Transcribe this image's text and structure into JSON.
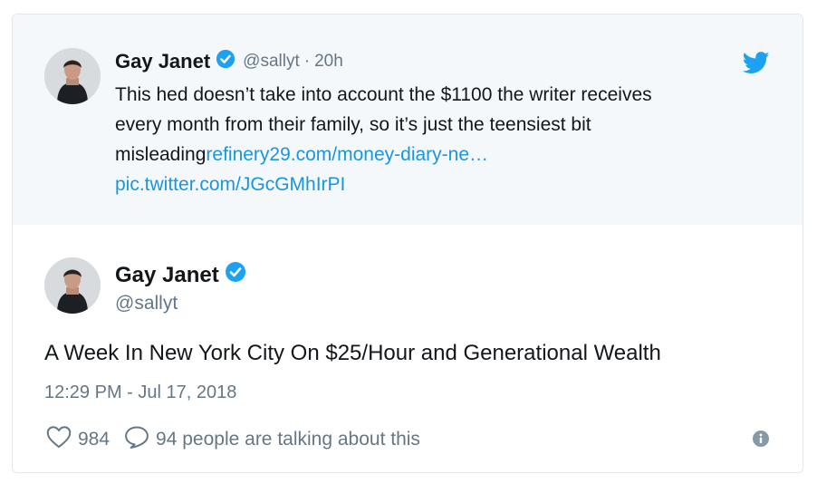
{
  "quoted_tweet": {
    "author_name": "Gay Janet",
    "handle": "@sallyt",
    "separator": "·",
    "time": "20h",
    "text_lines": [
      "This hed doesn’t take into account the $1100 the writer receives",
      "every month from their family, so it’s just the teensiest bit",
      "misleading"
    ],
    "link_1": "refinery29.com/money-diary-ne…",
    "link_2": "pic.twitter.com/JGcGMhIrPI"
  },
  "main_tweet": {
    "author_name": "Gay Janet",
    "handle": "@sallyt",
    "text": "A Week In New York City On $25/Hour and Generational Wealth",
    "date": "12:29 PM - Jul 17, 2018",
    "likes": "984",
    "replies_text": "94 people are talking about this"
  },
  "icons": [
    "verified-badge-icon",
    "twitter-bird-icon",
    "heart-icon",
    "speech-bubble-icon",
    "info-icon"
  ],
  "colors": {
    "link": "#1b95e0",
    "verified": "#1da1f2",
    "muted": "#657786",
    "quoted_bg": "#f5f8fa"
  }
}
